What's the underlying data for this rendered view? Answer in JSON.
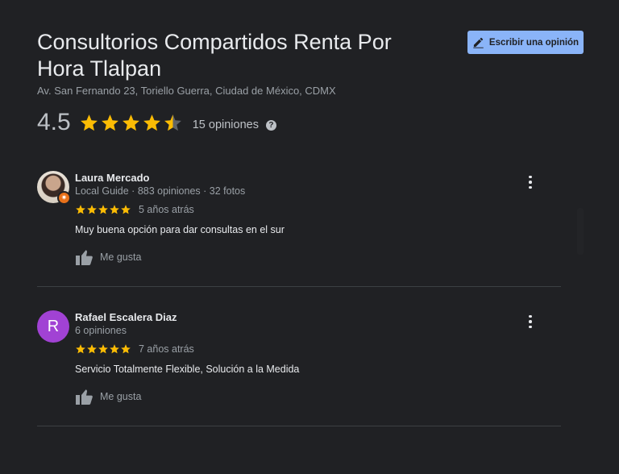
{
  "place": {
    "title": "Consultorios Compartidos Renta Por Hora Tlalpan",
    "address": "Av. San Fernando 23, Toriello Guerra, Ciudad de México, CDMX"
  },
  "write_review_button": {
    "label": "Escribir una opinión",
    "icon": "pencil-icon"
  },
  "summary": {
    "rating_text": "4.5",
    "rating": 4.5,
    "max_rating": 5,
    "count_label": "15 opiniones",
    "help_icon": "?"
  },
  "colors": {
    "background": "#202124",
    "accent": "#8ab4f8",
    "star": "#fbbc04",
    "star_empty": "#5f6368",
    "avatar_r": "#a142d4",
    "local_guide_badge": "#e8711a"
  },
  "reviews": [
    {
      "name": "Laura Mercado",
      "meta": "Local Guide · 883 opiniones · 32 fotos",
      "stars": 5,
      "date": "5 años atrás",
      "text": "Muy buena opción para dar consultas en el sur",
      "like_label": "Me gusta",
      "avatar_type": "photo",
      "local_guide": true
    },
    {
      "name": "Rafael Escalera Diaz",
      "meta": "6 opiniones",
      "stars": 5,
      "date": "7 años atrás",
      "text": "Servicio Totalmente Flexible, Solución a la Medida",
      "like_label": "Me gusta",
      "avatar_type": "letter",
      "avatar_letter": "R"
    }
  ]
}
